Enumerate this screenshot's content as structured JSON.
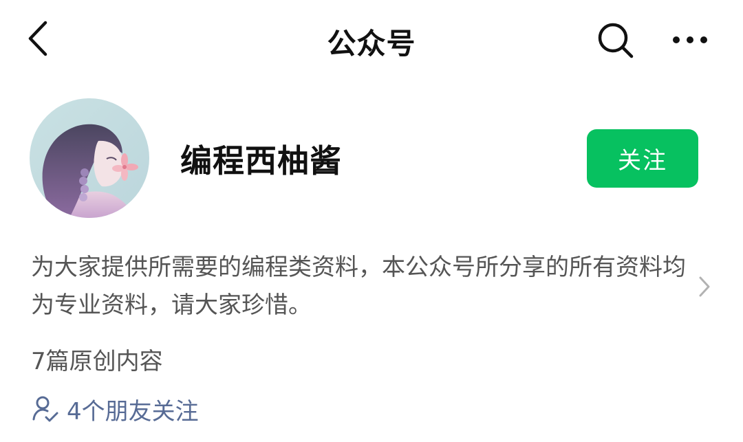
{
  "header": {
    "title": "公众号",
    "back_icon": "chevron-left-icon",
    "search_icon": "search-icon",
    "more_icon": "more-horizontal-icon"
  },
  "account": {
    "name": "编程西柚酱",
    "follow_label": "关注",
    "description": "为大家提供所需要的编程类资料，本公众号所分享的所有资料均为专业资料，请大家珍惜。",
    "original_count": "7篇原创内容",
    "friends_following": "4个朋友关注"
  },
  "colors": {
    "follow_button": "#07c160",
    "link": "#576b95",
    "secondary_text": "#555555"
  }
}
